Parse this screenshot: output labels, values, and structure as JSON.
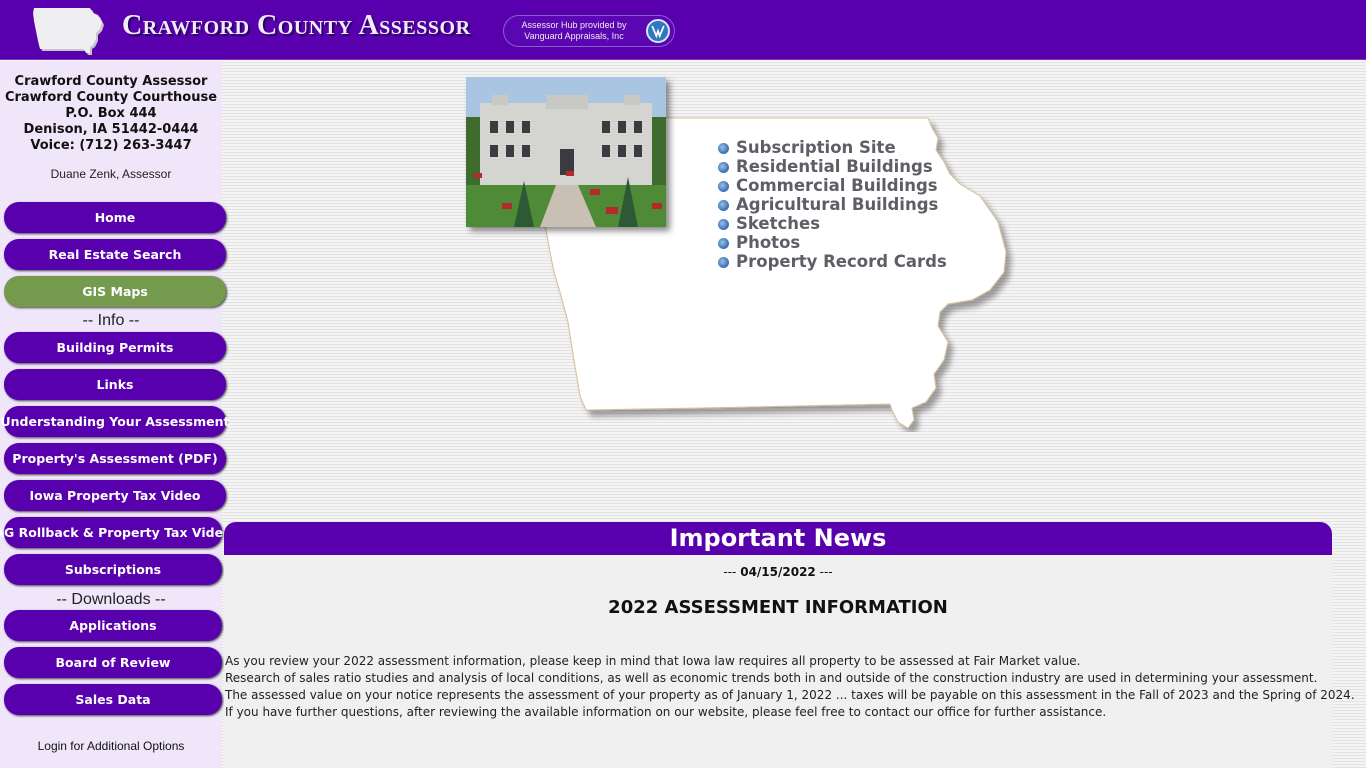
{
  "header": {
    "title": "Crawford County Assessor",
    "hub_badge_line1": "Assessor Hub provided by",
    "hub_badge_line2": "Vanguard Appraisals, Inc",
    "brand_color": "#5800ae"
  },
  "sidebar": {
    "address": [
      "Crawford County Assessor",
      "Crawford County Courthouse",
      "P.O. Box 444",
      "Denison, IA 51442-0444",
      "Voice: (712) 263-3447"
    ],
    "assessor_name": "Duane Zenk, Assessor",
    "nav": [
      {
        "label": "Home"
      },
      {
        "label": "Real Estate Search"
      },
      {
        "label": "GIS Maps",
        "highlight_color": "#749a4e"
      }
    ],
    "info_label": "-- Info --",
    "info_items": [
      {
        "label": "Building Permits"
      },
      {
        "label": "Links"
      },
      {
        "label": "Understanding Your Assessment"
      },
      {
        "label": "Property's Assessment (PDF)"
      },
      {
        "label": "Iowa Property Tax Video"
      },
      {
        "label": "AG Rollback & Property Tax Video"
      },
      {
        "label": "Subscriptions"
      }
    ],
    "downloads_label": "-- Downloads --",
    "download_items": [
      {
        "label": "Applications"
      },
      {
        "label": "Board of Review"
      },
      {
        "label": "Sales Data"
      }
    ],
    "login_label": "Login for Additional Options"
  },
  "features": [
    "Subscription Site",
    "Residential Buildings",
    "Commercial Buildings",
    "Agricultural Buildings",
    "Sketches",
    "Photos",
    "Property Record Cards"
  ],
  "news": {
    "heading": "Important News",
    "date_prefix": "---",
    "date": "04/15/2022",
    "date_suffix": "---",
    "title": "2022 ASSESSMENT INFORMATION",
    "paragraphs": [
      "As you review your 2022 assessment information, please keep in mind that Iowa law requires all property to be assessed at Fair Market value.",
      "Research of sales ratio studies and analysis of local conditions, as well as economic trends both in and outside of the construction industry are used in determining your assessment.",
      "The assessed value on your notice represents the assessment of your property as of January 1, 2022 ... taxes will be payable on this assessment in the Fall of 2023 and the Spring of 2024.",
      "If you have further questions, after reviewing the available information on our website, please feel free to contact our office for further assistance."
    ]
  }
}
